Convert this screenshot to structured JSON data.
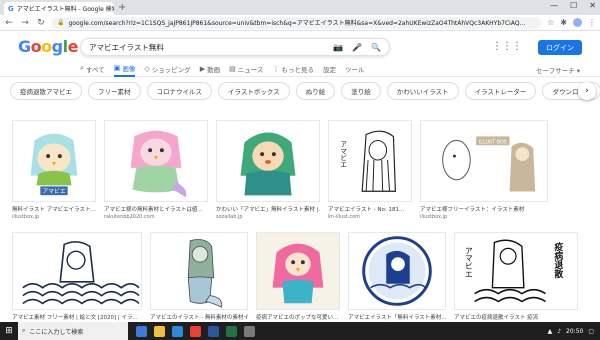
{
  "browser": {
    "tab_title": "アマビエイラスト無料 - Google 検索",
    "url": "google.com/search?rlz=1C1SQS_jaJP861JP861&source=univ&tbm=isch&q=アマビエイラスト無料&sa=X&ved=2ahUKEwizZaO4ThtAhVQc3AKHYb7CiAQ...",
    "minimize": "—",
    "maximize": "☐",
    "close": "✕"
  },
  "google": {
    "logo_letters": [
      "G",
      "o",
      "o",
      "g",
      "l",
      "e"
    ],
    "query": "アマビエイラスト無料",
    "login_label": "ログイン"
  },
  "nav": {
    "tabs": [
      {
        "label": "すべて",
        "icon": "search-icon"
      },
      {
        "label": "画像",
        "icon": "image-icon",
        "active": true
      },
      {
        "label": "ショッピング",
        "icon": "tag-icon"
      },
      {
        "label": "動画",
        "icon": "video-icon"
      },
      {
        "label": "ニュース",
        "icon": "news-icon"
      },
      {
        "label": "もっと見る",
        "icon": "more-icon"
      },
      {
        "label": "設定"
      },
      {
        "label": "ツール"
      }
    ],
    "safesearch": "セーフサーチ ▾"
  },
  "chips": [
    "疫病退散アマビエ",
    "フリー素材",
    "コロナウイルス",
    "イラストボックス",
    "ぬり絵",
    "塗り絵",
    "かわいいイラスト",
    "イラストレーター",
    "ダウンロード"
  ],
  "results_row1": [
    {
      "caption": "無料イラスト アマビエイラスト...",
      "source": "illustbox.jp"
    },
    {
      "caption": "アマビエ様の無料素材とイラストは値...",
      "source": "rakutenbb2020.com"
    },
    {
      "caption": "かわいい「アマビエ」無料イラスト素材 |...",
      "source": "sozailab.jp"
    },
    {
      "caption": "アマビエイラスト - No: 181...",
      "source": "kn-illust.com"
    },
    {
      "caption": "アマビエ様フリーイラスト：イラスト素材",
      "source": "illustbox.jp"
    }
  ],
  "results_row2": [
    {
      "caption": "アマビエ素材 フリー素材 | 絵と文 [2020] | イラ..."
    },
    {
      "caption": "アマビエのイラスト - 無料素材の素材イ..."
    },
    {
      "caption": "疫病アマビエのポップな可愛い..."
    },
    {
      "caption": "アマビエイラスト「無料イラスト素材..."
    },
    {
      "caption": "アマビエの疫病退散イラスト 疫流"
    }
  ],
  "illust_text": {
    "label_amabie": "アマビエ",
    "badge_illust_box": "ILLUST BOX",
    "vertical_amabie": "アマビエ",
    "vertical_ekibyo": "疫病退散"
  },
  "taskbar": {
    "search_placeholder": "ここに入力して検索",
    "time": "20:50"
  },
  "colors": {
    "google_blue": "#1a73e8",
    "taskbar": "#1f1f1f"
  }
}
